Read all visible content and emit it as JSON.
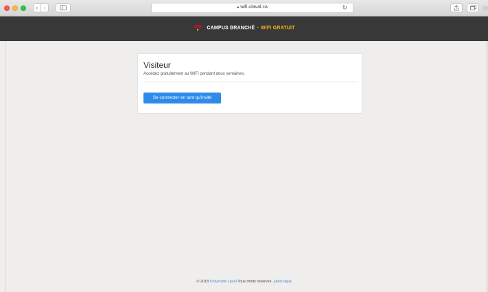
{
  "browser": {
    "url": "wifi.ulaval.ca",
    "colors": {
      "close": "#fc5753",
      "minimize": "#fdbc40",
      "zoom": "#33c748"
    },
    "icons": [
      "back-arrow-icon",
      "forward-arrow-icon",
      "sidebar-icon",
      "lock-icon",
      "reload-icon",
      "share-icon",
      "tabs-icon"
    ]
  },
  "header": {
    "brand_main": "CAMPUS BRANCHÉ",
    "brand_separator": "-",
    "brand_accent": "WIFI GRATUIT",
    "colors": {
      "background": "#383838",
      "accent": "#f1b71c",
      "logo": "#c8102e"
    }
  },
  "card": {
    "title": "Visiteur",
    "description": "Accédez gratuitement au WIFI pendant deux semaines.",
    "button_label": "Se connecter en tant qu'invité",
    "colors": {
      "button": "#2e8bea"
    }
  },
  "footer": {
    "copyright": "© 2018",
    "university_link": "Université Laval",
    "rights": "Tous droits réservés. |",
    "legal_link": "Avis légal",
    "colors": {
      "link": "#3a8bdc"
    }
  }
}
